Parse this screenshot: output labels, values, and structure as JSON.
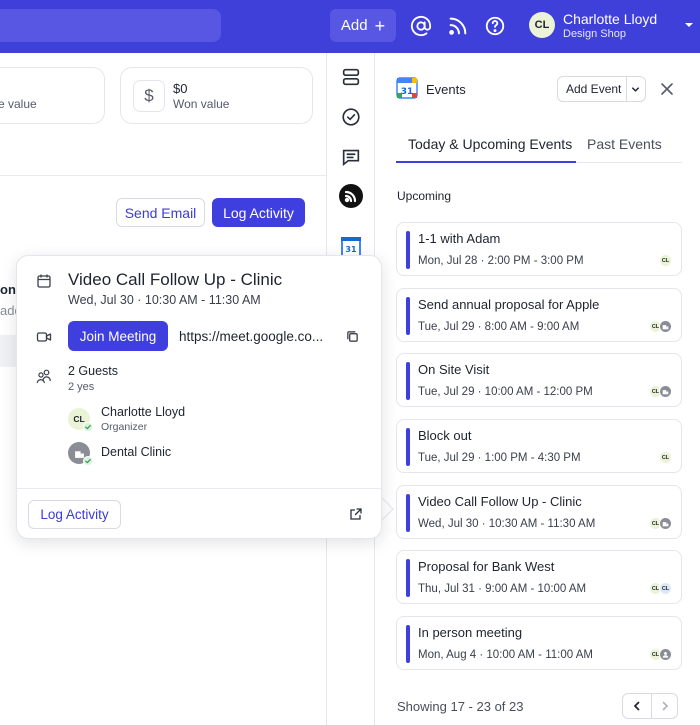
{
  "topbar": {
    "add_label": "Add",
    "user_initials": "CL",
    "user_name": "Charlotte Lloyd",
    "user_org": "Design Shop",
    "icons": [
      "at-icon",
      "rss-icon",
      "help-icon",
      "chevron-down-icon"
    ]
  },
  "main": {
    "stat_partial_label": "e value",
    "stat_won_value": "$0",
    "stat_won_label": "Won value",
    "send_email_label": "Send Email",
    "log_activity_label": "Log Activity",
    "bg_partial_1": "on.",
    "bg_partial_2": "add"
  },
  "popover": {
    "title": "Video Call Follow Up - Clinic",
    "time": "Wed, Jul 30 · 10:30 AM - 11:30 AM",
    "join_label": "Join Meeting",
    "meet_link": "https://meet.google.co...",
    "guests_title": "2 Guests",
    "guests_sub": "2 yes",
    "guests": [
      {
        "initials": "CL",
        "name": "Charlotte Lloyd",
        "role": "Organizer"
      },
      {
        "initials": "",
        "name": "Dental Clinic",
        "role": ""
      }
    ],
    "log_label": "Log Activity"
  },
  "events_panel": {
    "logo_text": "31",
    "title": "Events",
    "add_event_label": "Add Event",
    "tabs": [
      {
        "label": "Today & Upcoming Events",
        "active": true
      },
      {
        "label": "Past Events",
        "active": false
      }
    ],
    "section_label": "Upcoming",
    "events": [
      {
        "title": "1-1 with Adam",
        "time": "Mon, Jul 28 · 2:00 PM - 3:00 PM",
        "avatars": [
          "CL"
        ]
      },
      {
        "title": "Send annual proposal for Apple",
        "time": "Tue, Jul 29 · 8:00 AM - 9:00 AM",
        "avatars": [
          "CL",
          "org"
        ]
      },
      {
        "title": "On Site Visit",
        "time": "Tue, Jul 29 · 10:00 AM - 12:00 PM",
        "avatars": [
          "CL",
          "org"
        ]
      },
      {
        "title": "Block out",
        "time": "Tue, Jul 29 · 1:00 PM - 4:30 PM",
        "avatars": [
          "CL"
        ]
      },
      {
        "title": "Video Call Follow Up - Clinic",
        "time": "Wed, Jul 30 · 10:30 AM - 11:30 AM",
        "avatars": [
          "CL",
          "org"
        ]
      },
      {
        "title": "Proposal for Bank West",
        "time": "Thu, Jul 31 · 9:00 AM - 10:00 AM",
        "avatars": [
          "CL",
          "CL"
        ]
      },
      {
        "title": "In person meeting",
        "time": "Mon, Aug 4 · 10:00 AM - 11:00 AM",
        "avatars": [
          "CL",
          "person"
        ]
      }
    ],
    "showing_text": "Showing 17 - 23 of 23"
  },
  "colors": {
    "brand": "#3f3fd9",
    "accent": "#3f3fe0",
    "link": "#3b3bd6",
    "avatar_green": "#eaf3d6"
  }
}
